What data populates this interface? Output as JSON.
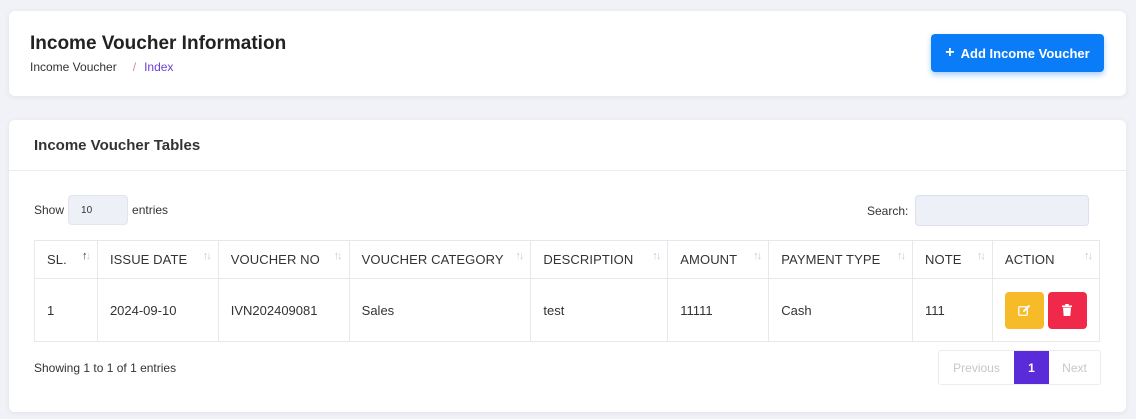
{
  "header": {
    "title": "Income Voucher Information",
    "breadcrumb": {
      "parent": "Income Voucher",
      "separator": "/",
      "current": "Index"
    },
    "add_button": {
      "icon": "plus-icon",
      "label": "Add Income Voucher"
    }
  },
  "table_card": {
    "title": "Income Voucher Tables",
    "length": {
      "show": "Show",
      "value": "10",
      "suffix": "entries"
    },
    "search": {
      "label": "Search:",
      "value": ""
    },
    "columns": [
      "SL.",
      "ISSUE DATE",
      "VOUCHER NO",
      "VOUCHER CATEGORY",
      "DESCRIPTION",
      "AMOUNT",
      "PAYMENT TYPE",
      "NOTE",
      "ACTION"
    ],
    "sort_glyph": "↑↓",
    "rows": [
      {
        "sl": "1",
        "issue_date": "2024-09-10",
        "voucher_no": "IVN202409081",
        "category": "Sales",
        "description": "test",
        "amount": "11111",
        "payment_type": "Cash",
        "note": "111",
        "actions": [
          "edit-icon",
          "trash-icon"
        ]
      }
    ],
    "info": "Showing 1 to 1 of 1 entries",
    "pagination": {
      "previous": "Previous",
      "current": "1",
      "next": "Next"
    }
  },
  "colors": {
    "primary": "#0b7cf7",
    "page_active": "#5a2bd9",
    "edit": "#f7bb2a",
    "delete": "#f0294a",
    "breadcrumb_active": "#6c3fd8"
  }
}
